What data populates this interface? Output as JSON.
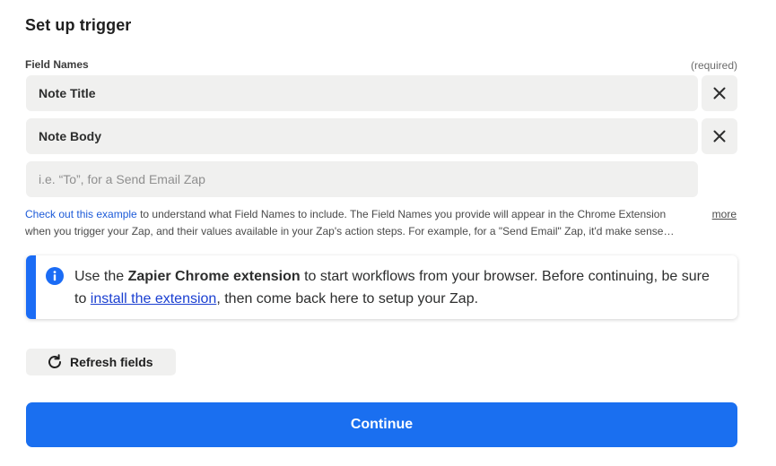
{
  "page": {
    "title": "Set up trigger"
  },
  "field_names": {
    "label": "Field Names",
    "required_text": "(required)",
    "fields": [
      {
        "value": "Note Title"
      },
      {
        "value": "Note Body"
      },
      {
        "value": "",
        "placeholder": "i.e. “To”, for a Send Email Zap"
      }
    ]
  },
  "help": {
    "link_text": "Check out this example",
    "text": " to understand what Field Names to include. The Field Names you provide will appear in the Chrome Extension when you trigger your Zap, and their values available in your Zap's action steps. For example, for a \"Send Email\" Zap, it'd make sense…",
    "more_label": "more"
  },
  "banner": {
    "icon": "info-icon",
    "text_before": "Use the ",
    "bold_text": "Zapier Chrome extension",
    "text_middle": " to start workflows from your browser. Before continuing, be sure to ",
    "link_text": "install the extension",
    "text_after": ", then come back here to setup your Zap."
  },
  "refresh_button": {
    "label": "Refresh fields",
    "icon": "refresh-icon"
  },
  "continue_button": {
    "label": "Continue"
  },
  "colors": {
    "accent": "#1a6ff0",
    "banner_accent": "#1b6cf5",
    "input_bg": "#f0f0ef",
    "link": "#1d5bd8"
  }
}
